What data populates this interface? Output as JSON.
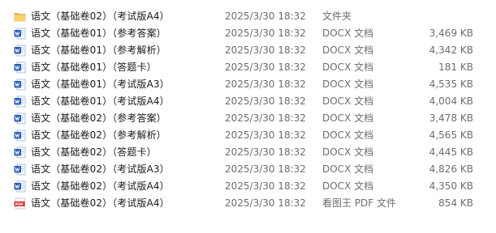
{
  "files": [
    {
      "icon": "folder-icon",
      "name": "语文（基础卷02）（考试版A4）",
      "date": "2025/3/30 18:32",
      "type": "文件夹",
      "size": ""
    },
    {
      "icon": "word-doc-icon",
      "name": "语文（基础卷01）（参考答案）",
      "date": "2025/3/30 18:32",
      "type": "DOCX 文档",
      "size": "3,469 KB"
    },
    {
      "icon": "word-doc-icon",
      "name": "语文（基础卷01）（参考解析）",
      "date": "2025/3/30 18:32",
      "type": "DOCX 文档",
      "size": "4,342 KB"
    },
    {
      "icon": "word-doc-icon",
      "name": "语文（基础卷01）（答题卡）",
      "date": "2025/3/30 18:32",
      "type": "DOCX 文档",
      "size": "181 KB"
    },
    {
      "icon": "word-doc-icon",
      "name": "语文（基础卷01）（考试版A3）",
      "date": "2025/3/30 18:32",
      "type": "DOCX 文档",
      "size": "4,535 KB"
    },
    {
      "icon": "word-doc-icon",
      "name": "语文（基础卷01）（考试版A4）",
      "date": "2025/3/30 18:32",
      "type": "DOCX 文档",
      "size": "4,004 KB"
    },
    {
      "icon": "word-doc-icon",
      "name": "语文（基础卷02）（参考答案）",
      "date": "2025/3/30 18:32",
      "type": "DOCX 文档",
      "size": "3,478 KB"
    },
    {
      "icon": "word-doc-icon",
      "name": "语文（基础卷02）（参考解析）",
      "date": "2025/3/30 18:32",
      "type": "DOCX 文档",
      "size": "4,565 KB"
    },
    {
      "icon": "word-doc-icon",
      "name": "语文（基础卷02）（答题卡）",
      "date": "2025/3/30 18:32",
      "type": "DOCX 文档",
      "size": "4,445 KB"
    },
    {
      "icon": "word-doc-icon",
      "name": "语文（基础卷02）（考试版A3）",
      "date": "2025/3/30 18:32",
      "type": "DOCX 文档",
      "size": "4,826 KB"
    },
    {
      "icon": "word-doc-icon",
      "name": "语文（基础卷02）（考试版A4）",
      "date": "2025/3/30 18:32",
      "type": "DOCX 文档",
      "size": "4,350 KB"
    },
    {
      "icon": "pdf-icon",
      "name": "语文（基础卷02）（考试版A4）",
      "date": "2025/3/30 18:32",
      "type": "看图王 PDF 文件",
      "size": "854 KB"
    }
  ],
  "colors": {
    "folder": "#e8b640",
    "word": "#2b5fb8",
    "pdf": "#c8312a"
  }
}
